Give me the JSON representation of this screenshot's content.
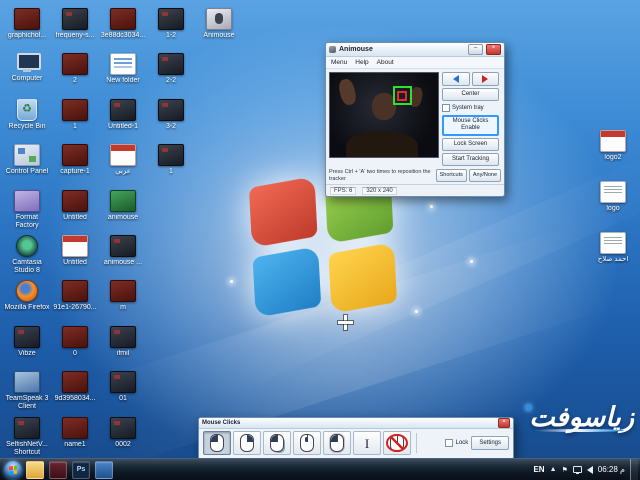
{
  "desktop": {
    "columns": [
      {
        "items": [
          {
            "label": "graphichol...",
            "icon": "file-red"
          },
          {
            "label": "Computer",
            "icon": "computer"
          },
          {
            "label": "Recycle Bin",
            "icon": "recycle-bin"
          },
          {
            "label": "Control Panel",
            "icon": "control-panel"
          },
          {
            "label": "Format Factory",
            "icon": "format-factory"
          },
          {
            "label": "Camtasia Studio 8",
            "icon": "camtasia"
          },
          {
            "label": "Mozilla Firefox",
            "icon": "firefox"
          },
          {
            "label": "Vibze",
            "icon": "file-dark"
          },
          {
            "label": "TeamSpeak 3 Client",
            "icon": "teamspeak"
          },
          {
            "label": "SelfishNetV... Shortcut",
            "icon": "file-dark"
          }
        ]
      },
      {
        "items": [
          {
            "label": "frequeny-s...",
            "icon": "file-dark"
          },
          {
            "label": "2",
            "icon": "file-red"
          },
          {
            "label": "1",
            "icon": "file-red"
          },
          {
            "label": "capture-1",
            "icon": "file-red"
          },
          {
            "label": "Untitled",
            "icon": "file-red"
          },
          {
            "label": "Untitled",
            "icon": "doc-red"
          },
          {
            "label": "91e1-26790...",
            "icon": "file-red"
          },
          {
            "label": "0",
            "icon": "file-red"
          },
          {
            "label": "9d3958034...",
            "icon": "file-red"
          },
          {
            "label": "name1",
            "icon": "file-red"
          }
        ]
      },
      {
        "items": [
          {
            "label": "3e88dc3034...",
            "icon": "file-red"
          },
          {
            "label": "New folder",
            "icon": "files-stack"
          },
          {
            "label": "Untitled-1",
            "icon": "file-dark"
          },
          {
            "label": "عربي",
            "icon": "doc-red"
          },
          {
            "label": "animouse",
            "icon": "app-green"
          },
          {
            "label": "animouse ...",
            "icon": "file-dark"
          },
          {
            "label": "m",
            "icon": "file-red"
          },
          {
            "label": "ifmil",
            "icon": "file-dark"
          },
          {
            "label": "01",
            "icon": "file-dark"
          },
          {
            "label": "0002",
            "icon": "file-dark"
          }
        ]
      },
      {
        "items": [
          {
            "label": "1-2",
            "icon": "file-dark"
          },
          {
            "label": "2-2",
            "icon": "file-dark"
          },
          {
            "label": "3-2",
            "icon": "file-dark"
          },
          {
            "label": "1",
            "icon": "file-dark"
          }
        ]
      },
      {
        "items": [
          {
            "label": "Animouse",
            "icon": "app-animouse"
          }
        ]
      }
    ],
    "right_items": [
      {
        "label": "logo2",
        "icon": "doc-red"
      },
      {
        "label": "logo",
        "icon": "doc-white"
      },
      {
        "label": "أحمد صلاح",
        "icon": "doc-white"
      }
    ]
  },
  "animouse": {
    "title": "Animouse",
    "menu": [
      "Menu",
      "Help",
      "About"
    ],
    "center_button": "Center",
    "system_tray_checkbox": "System tray",
    "side_buttons": [
      "Mouse Clicks Enable",
      "Lock Screen",
      "Start Tracking"
    ],
    "hint": "Press Ctrl + 'A' two times to reposition the tracker",
    "shortcuts_button": "Shortcuts",
    "any_button": "Any/None",
    "fps": "FPS: 6",
    "resolution": "320 x 240"
  },
  "mouse_clicks": {
    "title": "Mouse Clicks",
    "tools": [
      {
        "name": "left-click",
        "selected": true
      },
      {
        "name": "right-click",
        "selected": false
      },
      {
        "name": "double-click",
        "selected": false
      },
      {
        "name": "middle-click",
        "selected": false
      },
      {
        "name": "drag",
        "selected": false
      },
      {
        "name": "text-select",
        "selected": false
      },
      {
        "name": "no-click",
        "selected": false
      }
    ],
    "lock_label": "Lock",
    "settings_label": "Settings"
  },
  "taskbar": {
    "pinned": [
      {
        "name": "explorer"
      },
      {
        "name": "app-red"
      },
      {
        "name": "photoshop",
        "label": "Ps"
      },
      {
        "name": "app-blue"
      }
    ],
    "tray": {
      "language": "EN",
      "time": "06:28 م"
    }
  },
  "watermark": {
    "text": "زياسوفت"
  }
}
